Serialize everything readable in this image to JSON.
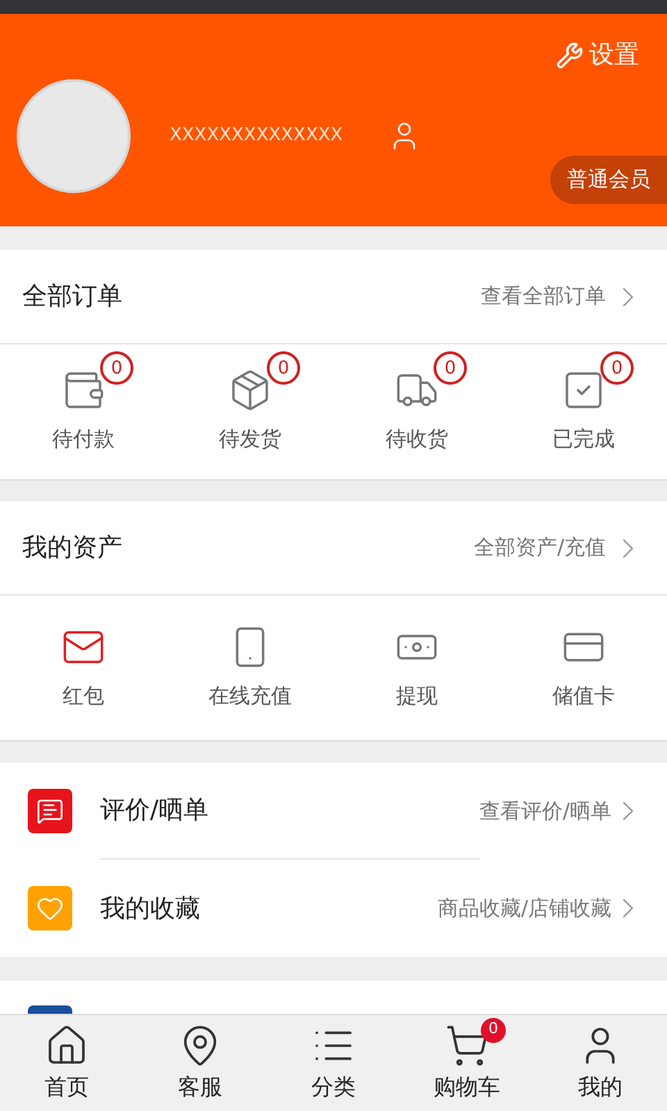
{
  "header": {
    "settings": "设置",
    "username": "XXXXXXXXXXXXXX",
    "member_level": "普通会员"
  },
  "orders": {
    "title": "全部订单",
    "link": "查看全部订单",
    "items": [
      {
        "kind": "wallet",
        "label": "待付款",
        "count": "0"
      },
      {
        "kind": "box",
        "label": "待发货",
        "count": "0"
      },
      {
        "kind": "truck",
        "label": "待收货",
        "count": "0"
      },
      {
        "kind": "check",
        "label": "已完成",
        "count": "0"
      }
    ]
  },
  "assets": {
    "title": "我的资产",
    "link": "全部资产/充值",
    "items": [
      {
        "kind": "envelope",
        "label": "红包"
      },
      {
        "kind": "phone",
        "label": "在线充值"
      },
      {
        "kind": "cash",
        "label": "提现"
      },
      {
        "kind": "cards",
        "label": "储值卡"
      }
    ]
  },
  "menu": [
    {
      "kind": "comment",
      "label": "评价/晒单",
      "link": "查看评价/晒单",
      "color": "#e8141c"
    },
    {
      "kind": "heart",
      "label": "我的收藏",
      "link": "商品收藏/店铺收藏",
      "color": "#ffa200"
    }
  ],
  "partial_row": {
    "color": "#1a4f9c"
  },
  "bottom_nav": [
    {
      "kind": "home",
      "label": "首页"
    },
    {
      "kind": "pin",
      "label": "客服"
    },
    {
      "kind": "list",
      "label": "分类"
    },
    {
      "kind": "cart",
      "label": "购物车",
      "badge": "0"
    },
    {
      "kind": "user",
      "label": "我的"
    }
  ]
}
